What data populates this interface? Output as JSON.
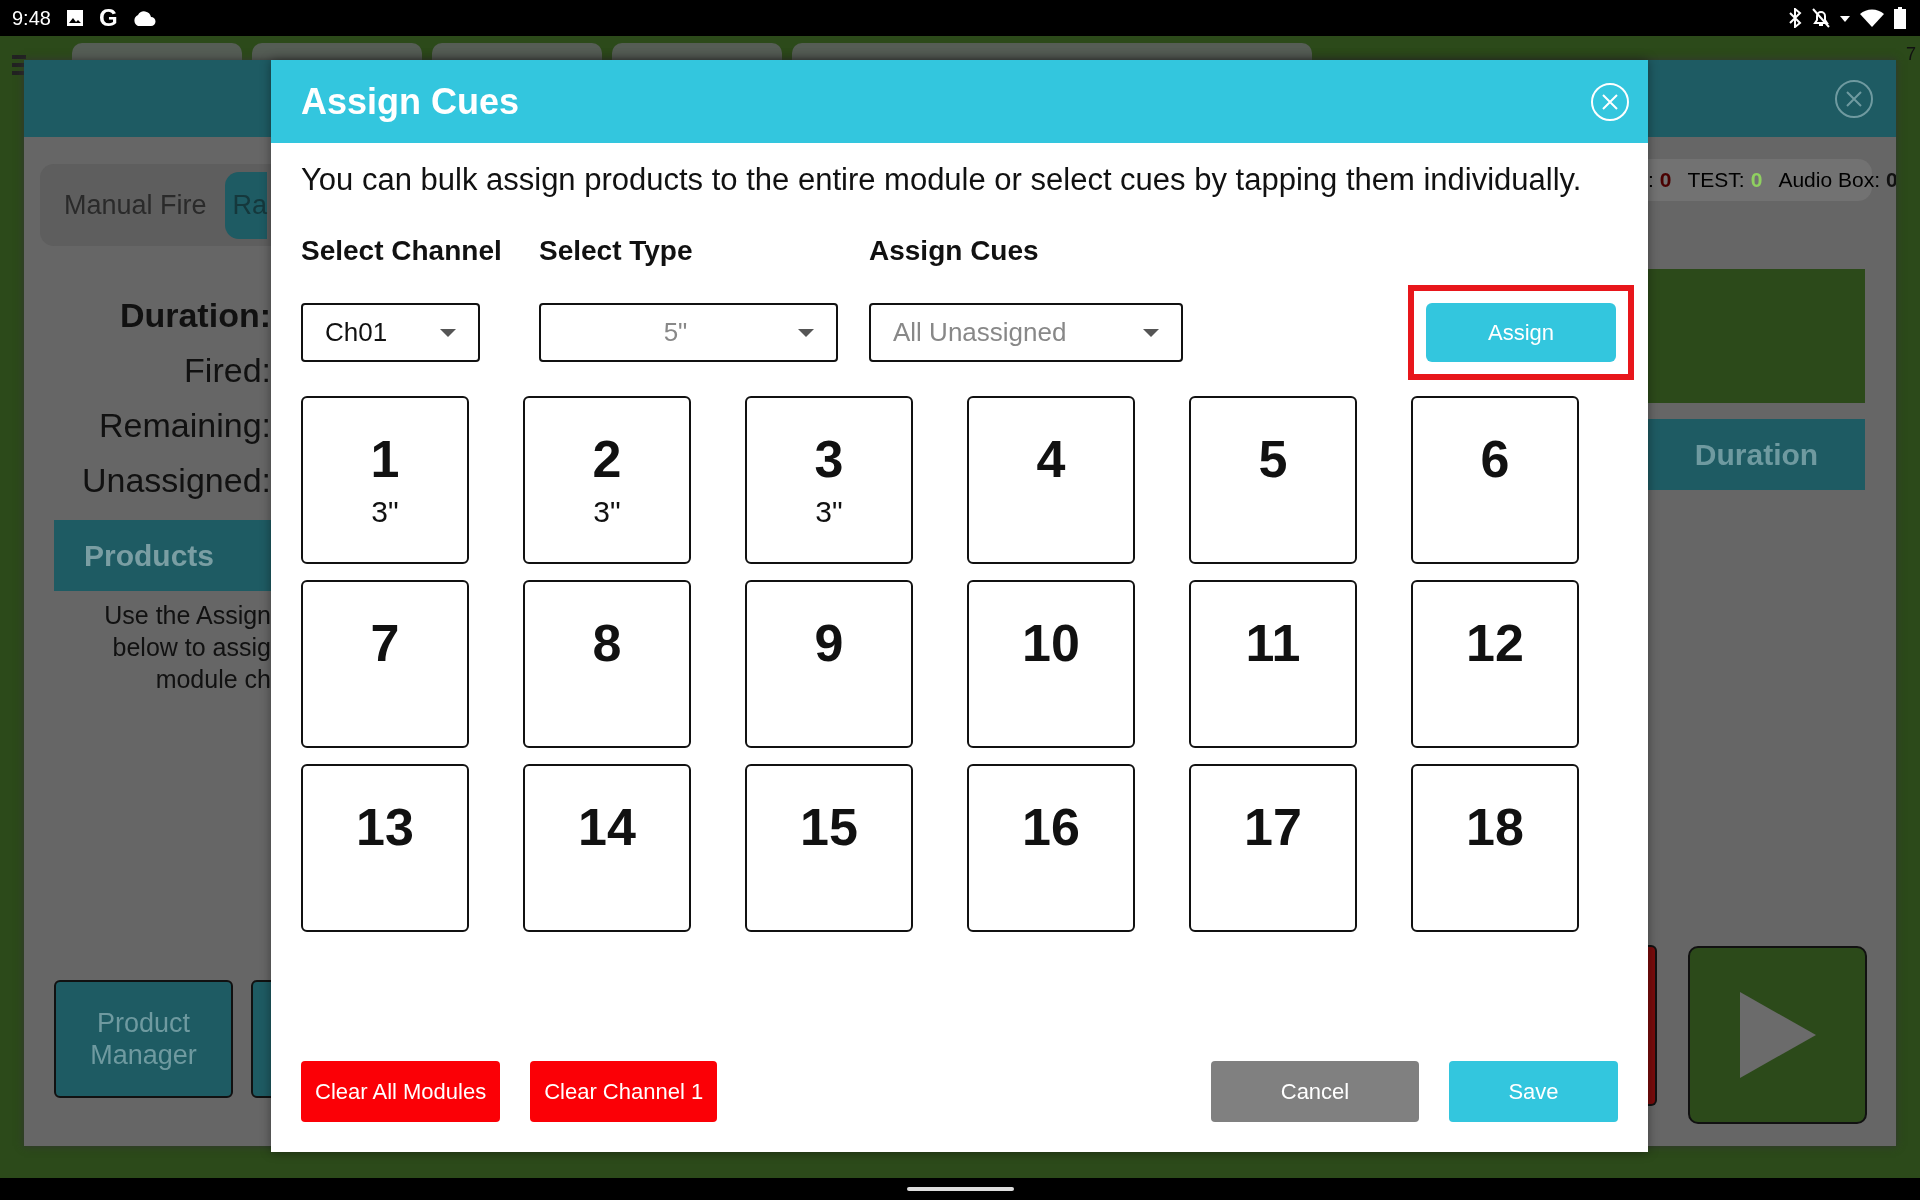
{
  "status_bar": {
    "time": "9:48",
    "g_label": "G"
  },
  "background": {
    "corner_text": "7",
    "tabs": [
      {
        "label": "Manual Fire",
        "selected": false
      },
      {
        "label": "Ra",
        "selected": true
      }
    ],
    "stats": [
      {
        "label": "Duration:",
        "emphasis": true
      },
      {
        "label": "Fired:",
        "emphasis": false
      },
      {
        "label": "Remaining:",
        "emphasis": false
      },
      {
        "label": "Unassigned:",
        "emphasis": false
      }
    ],
    "products_header": "Products",
    "products_hint": [
      "Use the Assign",
      "below to assig",
      "module ch"
    ],
    "product_manager_button": "Product Manager",
    "counters": [
      {
        "label": ":",
        "value": "0",
        "kind": "error"
      },
      {
        "label": "TEST:",
        "value": "0",
        "kind": "ok"
      },
      {
        "label": "Audio Box:",
        "value": "0",
        "kind": "plain"
      }
    ],
    "duration_header": "Duration"
  },
  "dialog": {
    "title": "Assign Cues",
    "description": "You can bulk assign products to the entire module or select cues by tapping them individually.",
    "fields": [
      {
        "label": "Select Channel",
        "value": "Ch01",
        "disabled": false
      },
      {
        "label": "Select Type",
        "value": "5\"",
        "disabled": true
      },
      {
        "label": "Assign Cues",
        "value": "All Unassigned",
        "disabled": true
      }
    ],
    "assign_button": "Assign",
    "assign_highlighted": true,
    "cues": [
      {
        "number": "1",
        "type": "3\""
      },
      {
        "number": "2",
        "type": "3\""
      },
      {
        "number": "3",
        "type": "3\""
      },
      {
        "number": "4"
      },
      {
        "number": "5"
      },
      {
        "number": "6"
      },
      {
        "number": "7"
      },
      {
        "number": "8"
      },
      {
        "number": "9"
      },
      {
        "number": "10"
      },
      {
        "number": "11"
      },
      {
        "number": "12"
      },
      {
        "number": "13"
      },
      {
        "number": "14"
      },
      {
        "number": "15"
      },
      {
        "number": "16"
      },
      {
        "number": "17"
      },
      {
        "number": "18"
      }
    ],
    "buttons": [
      {
        "label": "Clear All Modules",
        "kind": "danger"
      },
      {
        "label": "Clear Channel 1",
        "kind": "danger"
      },
      {
        "label": "Cancel",
        "kind": "neutral"
      },
      {
        "label": "Save",
        "kind": "primary"
      }
    ]
  }
}
